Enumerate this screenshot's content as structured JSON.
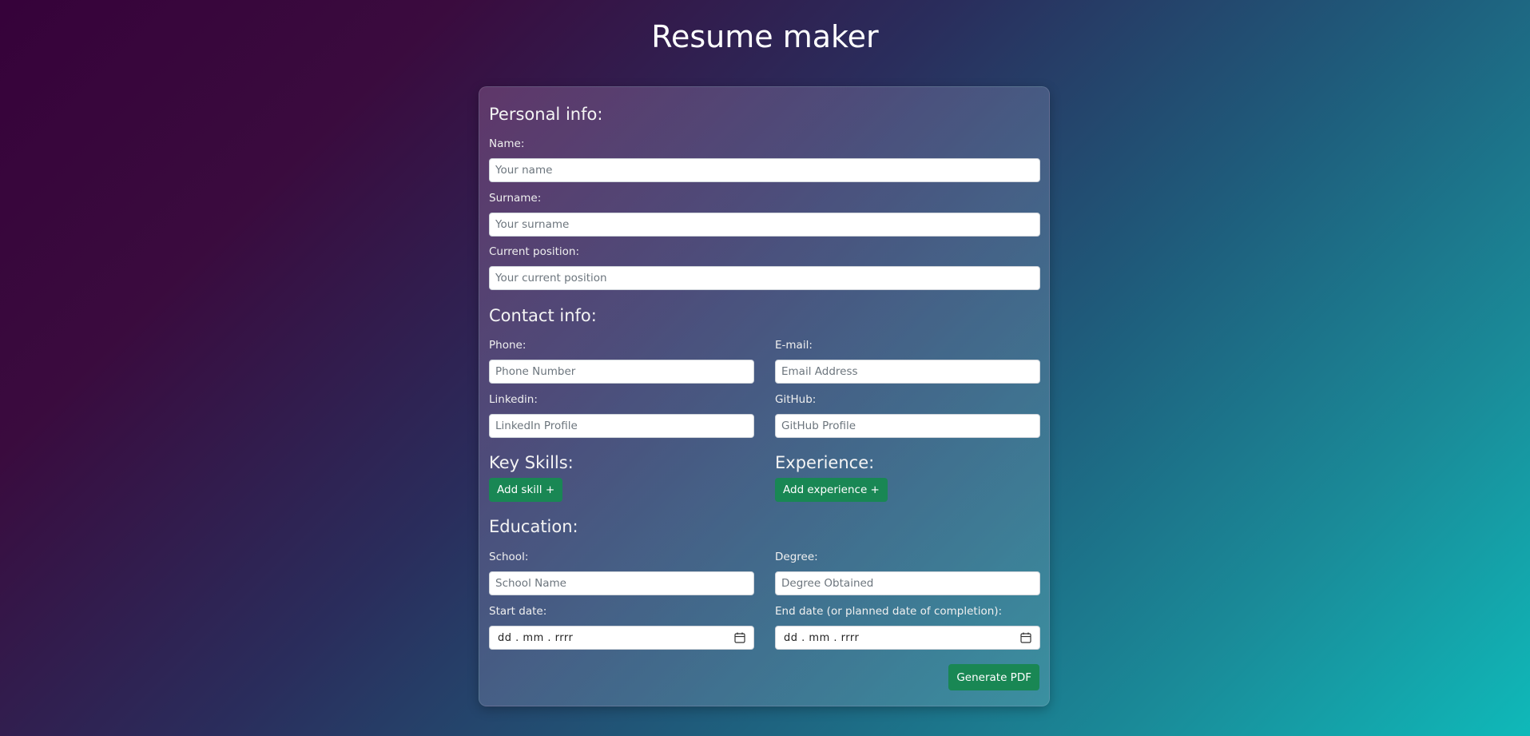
{
  "page": {
    "title": "Resume maker"
  },
  "personal": {
    "heading": "Personal info:",
    "name_label": "Name:",
    "name_placeholder": "Your name",
    "surname_label": "Surname:",
    "surname_placeholder": "Your surname",
    "position_label": "Current position:",
    "position_placeholder": "Your current position"
  },
  "contact": {
    "heading": "Contact info:",
    "phone_label": "Phone:",
    "phone_placeholder": "Phone Number",
    "email_label": "E-mail:",
    "email_placeholder": "Email Address",
    "linkedin_label": "Linkedin:",
    "linkedin_placeholder": "LinkedIn Profile",
    "github_label": "GitHub:",
    "github_placeholder": "GitHub Profile"
  },
  "skills": {
    "heading": "Key Skills:",
    "add_label": "Add skill +"
  },
  "experience": {
    "heading": "Experience:",
    "add_label": "Add experience +"
  },
  "education": {
    "heading": "Education:",
    "school_label": "School:",
    "school_placeholder": "School Name",
    "degree_label": "Degree:",
    "degree_placeholder": "Degree Obtained",
    "start_label": "Start date:",
    "start_value": "dd . mm . rrrr",
    "end_label": "End date (or planned date of completion):",
    "end_value": "dd . mm . rrrr",
    "calendar_icon": "calendar-icon"
  },
  "actions": {
    "generate_label": "Generate PDF"
  },
  "colors": {
    "button": "#198754",
    "input_bg": "#ffffff"
  }
}
